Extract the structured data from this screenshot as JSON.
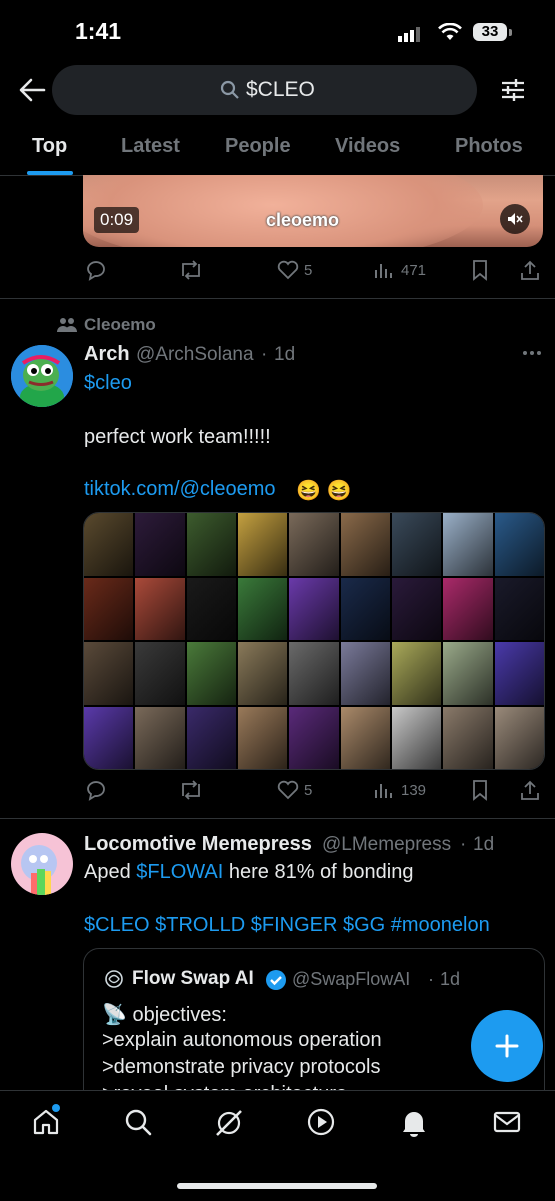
{
  "status_bar": {
    "time": "1:41",
    "battery": "33"
  },
  "header": {
    "search_query": "$CLEO",
    "tabs": [
      {
        "label": "Top"
      },
      {
        "label": "Latest"
      },
      {
        "label": "People"
      },
      {
        "label": "Videos"
      },
      {
        "label": "Photos"
      }
    ]
  },
  "post1": {
    "video_duration": "0:09",
    "watermark": "cleoemo",
    "likes": "5",
    "views": "471"
  },
  "post2": {
    "community": "Cleoemo",
    "name": "Arch",
    "handle": "@ArchSolana",
    "time": "1d",
    "cashtag": "$cleo",
    "text": "perfect work team!!!!!",
    "link": "tiktok.com/@cleoemo",
    "emoji": "😆 😆",
    "likes": "5",
    "views": "139"
  },
  "post3": {
    "name": "Locomotive Memepress",
    "handle": "@LMemepress",
    "time": "1d",
    "text_prefix": "Aped ",
    "cashtag": "$FLOWAI",
    "text_suffix": " here 81% of bonding",
    "tags": "$CLEO $TROLLD $FINGER $GG #moonelon",
    "quote": {
      "name": "Flow Swap AI",
      "handle": "@SwapFlowAI",
      "time": "1d",
      "lines": [
        "📡 objectives:",
        ">explain autonomous operation",
        ">demonstrate privacy protocols",
        ">reveal system architecture"
      ]
    }
  },
  "colors": {
    "accent": "#1d9bf0",
    "background": "#000000",
    "muted": "#71767b"
  }
}
